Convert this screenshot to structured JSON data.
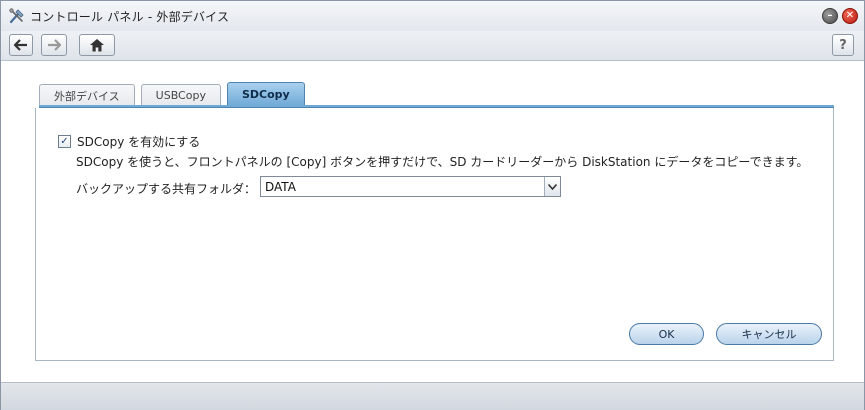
{
  "window": {
    "title": "コントロール パネル - 外部デバイス"
  },
  "toolbar": {
    "back_icon": "arrow-left-icon",
    "forward_icon": "arrow-right-icon",
    "home_icon": "home-icon",
    "help_label": "?"
  },
  "tabs": [
    {
      "label": "外部デバイス",
      "active": false
    },
    {
      "label": "USBCopy",
      "active": false
    },
    {
      "label": "SDCopy",
      "active": true
    }
  ],
  "sdcopy": {
    "enable_label": "SDCopy を有効にする",
    "enabled": true,
    "description": "SDCopy を使うと、フロントパネルの [Copy] ボタンを押すだけで、SD カードリーダーから DiskStation にデータをコピーできます。",
    "folder_label": "バックアップする共有フォルダ：",
    "folder_value": "DATA"
  },
  "buttons": {
    "ok": "OK",
    "cancel": "キャンセル"
  },
  "colors": {
    "active_tab": "#6fa9d6",
    "button_border": "#4b79a6",
    "close_button": "#d0281a"
  }
}
